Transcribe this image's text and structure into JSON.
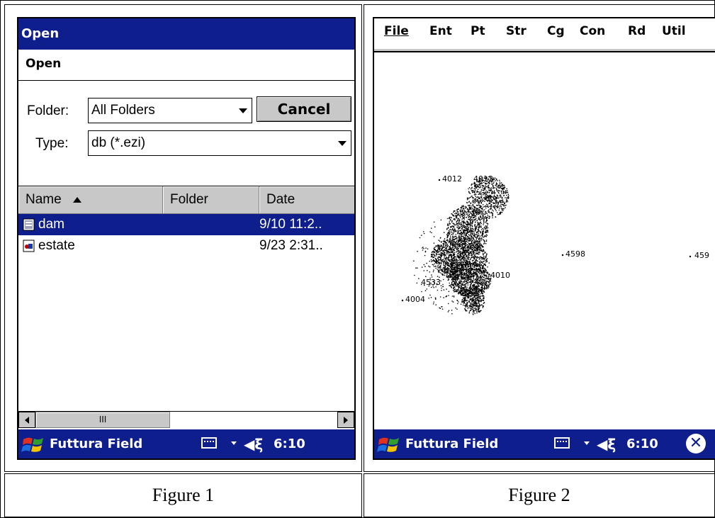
{
  "figure1": {
    "window_title": "Open",
    "dialog_heading": "Open",
    "folder_label": "Folder:",
    "folder_value": "All Folders",
    "cancel_label": "Cancel",
    "type_label": "Type:",
    "type_value": "db (*.ezi)",
    "columns": {
      "name": "Name",
      "folder": "Folder",
      "date": "Date"
    },
    "files": [
      {
        "name": "dam",
        "date": "9/10 11:2..",
        "selected": true,
        "icon": "database-file-icon"
      },
      {
        "name": "estate",
        "date": "9/23 2:31..",
        "selected": false,
        "icon": "estate-file-icon"
      }
    ],
    "scroll_thumb_glyph": "III",
    "taskbar": {
      "app": "Futtura Field",
      "speaker": "◀ξ",
      "time": "6:10"
    },
    "caption": "Figure 1"
  },
  "figure2": {
    "menu": [
      "File",
      "Ent",
      "Pt",
      "Str",
      "Cg",
      "Con",
      "Rd",
      "Util"
    ],
    "point_labels": [
      "4012",
      "4013",
      "4010",
      "4533",
      "4004",
      "4598",
      "459"
    ],
    "taskbar": {
      "app": "Futtura Field",
      "speaker": "◀ξ",
      "time": "6:10",
      "close": "✕"
    },
    "caption": "Figure 2"
  },
  "colors": {
    "titlebar": "#0e1e8c",
    "button_face": "#c8c8c8"
  }
}
